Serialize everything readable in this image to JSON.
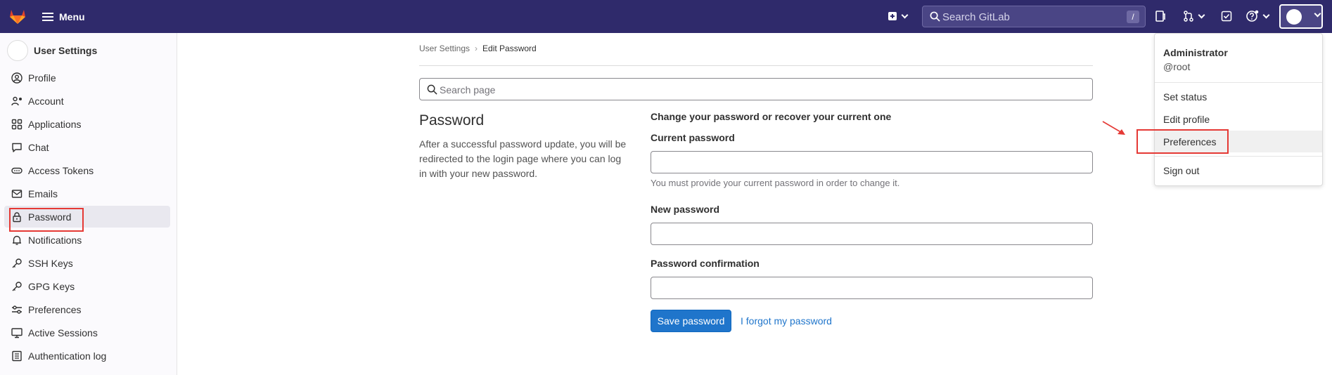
{
  "topbar": {
    "menu_label": "Menu",
    "search_placeholder": "Search GitLab",
    "search_shortcut": "/"
  },
  "sidebar": {
    "title": "User Settings",
    "items": [
      {
        "label": "Profile",
        "icon": "profile-icon"
      },
      {
        "label": "Account",
        "icon": "account-icon"
      },
      {
        "label": "Applications",
        "icon": "applications-icon"
      },
      {
        "label": "Chat",
        "icon": "chat-icon"
      },
      {
        "label": "Access Tokens",
        "icon": "token-icon"
      },
      {
        "label": "Emails",
        "icon": "mail-icon"
      },
      {
        "label": "Password",
        "icon": "lock-icon",
        "active": true
      },
      {
        "label": "Notifications",
        "icon": "bell-icon"
      },
      {
        "label": "SSH Keys",
        "icon": "key-icon"
      },
      {
        "label": "GPG Keys",
        "icon": "key-icon"
      },
      {
        "label": "Preferences",
        "icon": "preferences-icon"
      },
      {
        "label": "Active Sessions",
        "icon": "monitor-icon"
      },
      {
        "label": "Authentication log",
        "icon": "log-icon"
      }
    ]
  },
  "breadcrumb": {
    "parent": "User Settings",
    "current": "Edit Password"
  },
  "page_search": {
    "placeholder": "Search page"
  },
  "section": {
    "title": "Password",
    "description": "After a successful password update, you will be redirected to the login page where you can log in with your new password."
  },
  "form": {
    "heading": "Change your password or recover your current one",
    "current_label": "Current password",
    "current_help": "You must provide your current password in order to change it.",
    "new_label": "New password",
    "confirm_label": "Password confirmation",
    "save_label": "Save password",
    "forgot_label": "I forgot my password"
  },
  "dropdown": {
    "name": "Administrator",
    "username": "@root",
    "items": [
      "Set status",
      "Edit profile",
      "Preferences",
      "Sign out"
    ]
  },
  "colors": {
    "topbar": "#2f2a6b",
    "primary": "#1f75cb",
    "highlight": "#e53935"
  }
}
